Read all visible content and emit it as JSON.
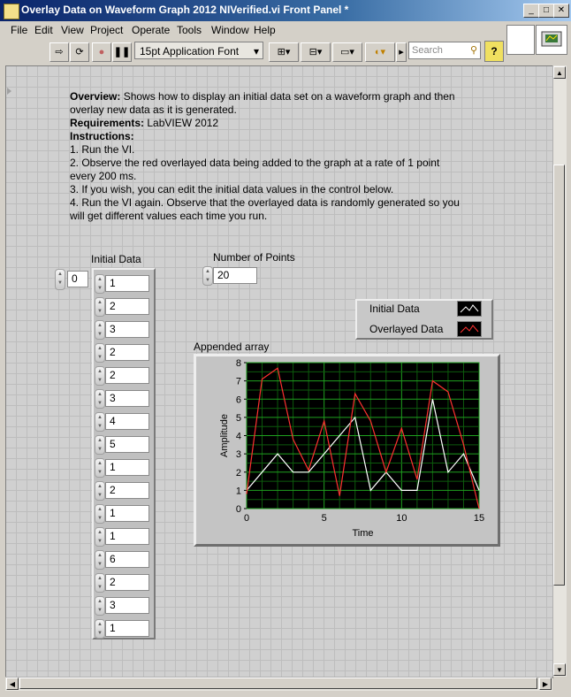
{
  "window": {
    "title": "Overlay Data on Waveform Graph 2012 NIVerified.vi Front Panel *"
  },
  "menu": [
    "File",
    "Edit",
    "View",
    "Project",
    "Operate",
    "Tools",
    "Window",
    "Help"
  ],
  "toolbar": {
    "font": "15pt Application Font",
    "search_placeholder": "Search",
    "help": "?"
  },
  "description": {
    "overview_label": "Overview:",
    "overview_text": " Shows how to display an initial data set on a waveform graph and then overlay new data as it is generated.",
    "requirements_label": "Requirements:",
    "requirements_text": " LabVIEW 2012",
    "instructions_label": "Instructions:",
    "steps": [
      "1. Run the VI.",
      "2. Observe the red overlayed data being added to the graph at a rate of 1 point every 200 ms.",
      "3. If you wish, you can edit the initial data values in the control below.",
      "4. Run the VI again. Observe that the overlayed data is randomly generated so you will get different values each time you run."
    ]
  },
  "initial_data": {
    "label": "Initial Data",
    "index": "0",
    "values": [
      "1",
      "2",
      "3",
      "2",
      "2",
      "3",
      "4",
      "5",
      "1",
      "2",
      "1",
      "1",
      "6",
      "2",
      "3",
      "1"
    ]
  },
  "num_points": {
    "label": "Number of Points",
    "value": "20"
  },
  "legend": {
    "items": [
      {
        "name": "Initial Data",
        "color": "#ffffff"
      },
      {
        "name": "Overlayed Data",
        "color": "#ff3030"
      }
    ]
  },
  "graph": {
    "label": "Appended array"
  },
  "chart_data": {
    "type": "line",
    "title": "Appended array",
    "xlabel": "Time",
    "ylabel": "Amplitude",
    "xlim": [
      0,
      15
    ],
    "ylim": [
      0,
      8
    ],
    "xticks": [
      "0",
      "5",
      "10",
      "15"
    ],
    "yticks": [
      "0",
      "1",
      "2",
      "3",
      "4",
      "5",
      "6",
      "7",
      "8"
    ],
    "grid": true,
    "series": [
      {
        "name": "Initial Data",
        "color": "#ffffff",
        "x": [
          0,
          1,
          2,
          3,
          4,
          5,
          6,
          7,
          8,
          9,
          10,
          11,
          12,
          13,
          14,
          15
        ],
        "y": [
          1,
          2,
          3,
          2,
          2,
          3,
          4,
          5,
          1,
          2,
          1,
          1,
          6,
          2,
          3,
          1
        ]
      },
      {
        "name": "Overlayed Data",
        "color": "#ff3030",
        "x": [
          0,
          1,
          2,
          3,
          4,
          5,
          6,
          7,
          8,
          9,
          10,
          11,
          12,
          13,
          14,
          15
        ],
        "y": [
          0.8,
          7.1,
          7.7,
          3.8,
          2.1,
          4.8,
          0.7,
          6.3,
          4.8,
          2.0,
          4.4,
          1.6,
          7.0,
          6.4,
          3.5,
          0.0
        ]
      }
    ]
  }
}
